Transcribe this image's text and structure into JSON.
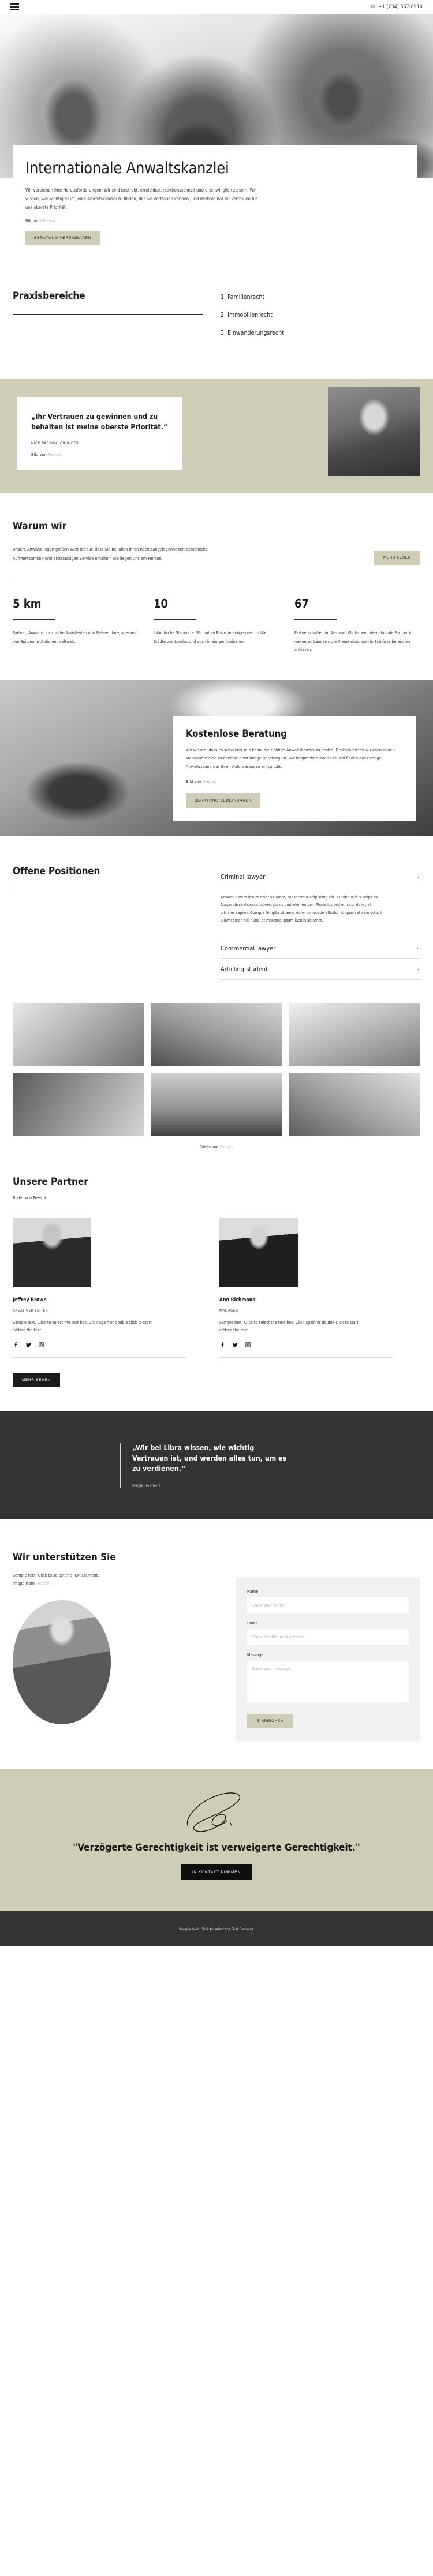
{
  "topbar": {
    "menu_icon": "hamburger-icon",
    "phone_icon": "phone-icon",
    "phone": "+1 (234) 567-8910"
  },
  "hero": {
    "title": "Internationale Anwaltskanzlei",
    "body": "Wir verstehen Ihre Herausforderungen. Wir sind bestrebt, erreichbar, reaktionsschnell und erschwinglich zu sein. Wir wissen, wie wichtig es ist, eine Anwaltskanzlei zu finden, der Sie vertrauen können, und deshalb hat Ihr Vertrauen für uns oberste Priorität.",
    "credit_prefix": "Bild von ",
    "credit_link": "Freepik",
    "cta": "BERATUNG VEREINBAREN"
  },
  "practice": {
    "heading": "Praxisbereiche",
    "items": [
      "1. Familienrecht",
      "2. Immobilienrecht",
      "3. Einwanderungsrecht"
    ]
  },
  "testimonial": {
    "quote": "„Ihr Vertrauen zu gewinnen und zu behalten ist meine oberste Priorität.“",
    "author": "NICK PARSON, GRÜNDER",
    "credit_prefix": "Bild von ",
    "credit_link": "Freepik"
  },
  "why": {
    "heading": "Warum wir",
    "body": "Unsere Anwälte legen großen Wert darauf, dass Sie bei allen Ihren Rechtsangelegenheiten persönliche Aufmerksamkeit und erstklassigen Service erhalten. Sie liegen uns am Herzen.",
    "cta": "MEHR LESEN"
  },
  "stats": [
    {
      "number": "5 km",
      "desc": "Partner, Anwälte, juristische Assistenten und Referendare, allesamt von Spitzeninstitutionen weltweit."
    },
    {
      "number": "10",
      "desc": "Inländische Standorte. Wir haben Büros in einigen der größten Städte des Landes und auch in einigen kleineren."
    },
    {
      "number": "67",
      "desc": "Partnerschaften im Ausland. Wir haben internationale Partner in mehreren Ländern, die Dienstleistungen in Schlüsselbereichen anbieten."
    }
  ],
  "consultation": {
    "heading": "Kostenlose Beratung",
    "body": "Wir wissen, dass es schwierig sein kann, die richtige Anwaltskanzlei zu finden. Deshalb bieten wir allen neuen Mandanten eine kostenlose einstündige Beratung an. Wir besprechen Ihren Fall und finden das richtige Anwaltsteam, das Ihren Anforderungen entspricht.",
    "credit_prefix": "Bild von ",
    "credit_link": "Freepik",
    "cta": "BERATUNG VEREINBAREN"
  },
  "positions": {
    "heading": "Offene Positionen",
    "items": [
      {
        "title": "Criminal lawyer",
        "icon": "chevron-down-icon",
        "expanded": true,
        "body": "Answer. Lorem ipsum dolor sit amet, consectetur adipiscing elit. Curabitur id suscipit ex. Suspendisse rhoncus laoreet purus quis elementum. Phasellus sed efficitur dolor, et ultricies sapien. Quisque fringilla sit amet dolor commodo efficitur. Aliquam et sem odio. In ullamcorper nisi nunc, et molestie ipsum iaculis sit amet."
      },
      {
        "title": "Commercial lawyer",
        "icon": "chevron-down-icon",
        "expanded": false,
        "body": ""
      },
      {
        "title": "Articling student",
        "icon": "chevron-down-icon",
        "expanded": false,
        "body": ""
      }
    ]
  },
  "gallery": {
    "credit_prefix": "Bilder von ",
    "credit_link": "Freepik"
  },
  "partners": {
    "heading": "Unsere Partner",
    "sub": "Bilder von Freepik",
    "people": [
      {
        "name": "Jeffrey Brown",
        "role": "KREATIVER LEITER",
        "bio": "Sample text. Click to select the text box. Click again or double click to start editing the text.",
        "socials": [
          "facebook-icon",
          "twitter-icon",
          "instagram-icon"
        ]
      },
      {
        "name": "Ann Richmond",
        "role": "MANAGER",
        "bio": "Sample text. Click to select the text box. Click again or double click to start editing the text.",
        "socials": [
          "facebook-icon",
          "twitter-icon",
          "instagram-icon"
        ]
      }
    ],
    "cta": "MEHR SEHEN"
  },
  "dark_quote": {
    "quote": "„Wir bei Libra wissen, wie wichtig Vertrauen ist, und werden alles tun, um es zu verdienen.“",
    "author": "Marge Heathore"
  },
  "support": {
    "heading": "Wir unterstützen Sie",
    "text": "Sample text. Click to select the Text Element.",
    "image_prefix": "Image from ",
    "image_link": "Freepik",
    "form": {
      "name_label": "Name",
      "name_placeholder": "Enter your Name",
      "email_label": "Email",
      "email_placeholder": "Enter a valid email address",
      "message_label": "Message",
      "message_placeholder": "Enter your message",
      "submit": "EINREICHEN"
    }
  },
  "cta_band": {
    "signature_icon": "signature-icon",
    "quote": "\"Verzögerte Gerechtigkeit ist verweigerte Gerechtigkeit.\"",
    "button": "IN KONTAKT KOMMEN"
  },
  "footer": {
    "text": "Sample text. Click to select the Text Element."
  },
  "colors": {
    "beige": "#cfcdb8",
    "dark": "#333333",
    "black": "#0f0f0f",
    "muted_link": "#b9b9b9"
  }
}
